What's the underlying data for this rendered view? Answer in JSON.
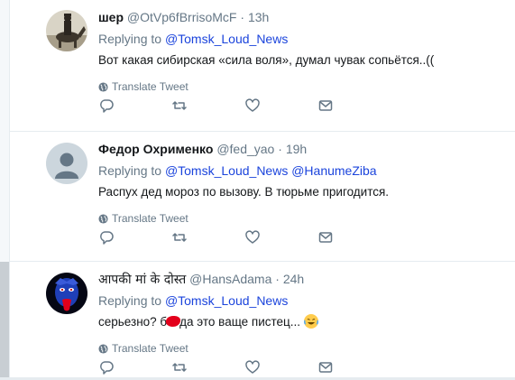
{
  "translate_label": "Translate Tweet",
  "colors": {
    "link": "#1b44dc",
    "muted": "#657786",
    "text": "#14171a",
    "censor_blot": "#e3001b"
  },
  "tweets": [
    {
      "fullname": "шер",
      "screen_name": "@OtVp6fBrrisoMcF",
      "separator": "·",
      "time": "13h",
      "replying_prefix": "Replying to",
      "mentions": [
        "@Tomsk_Loud_News"
      ],
      "text": "Вот какая сибирская «сила воля», думал чувак сопьётся..((",
      "avatar": "sepia-photo-rider-on-horse"
    },
    {
      "fullname": "Федор Охрименко",
      "screen_name": "@fed_yao",
      "separator": "·",
      "time": "19h",
      "replying_prefix": "Replying to",
      "mentions": [
        "@Tomsk_Loud_News",
        "@HanumeZiba"
      ],
      "text": "Распух дед мороз по вызову.  В тюрьме пригодится.",
      "avatar": "default-user-silhouette"
    },
    {
      "fullname": "आपकी मां के दोस्त",
      "screen_name": "@HansAdama",
      "separator": "·",
      "time": "24h",
      "replying_prefix": "Replying to",
      "mentions": [
        "@Tomsk_Loud_News"
      ],
      "text_before": "серьезно? б",
      "text_after": "да это ваще пистец...",
      "emoji": "crying-laughing-emoji",
      "avatar": "dark-blue-face-red-tongue"
    }
  ],
  "action_icons": [
    "reply-icon",
    "retweet-icon",
    "like-icon",
    "direct-message-icon"
  ]
}
